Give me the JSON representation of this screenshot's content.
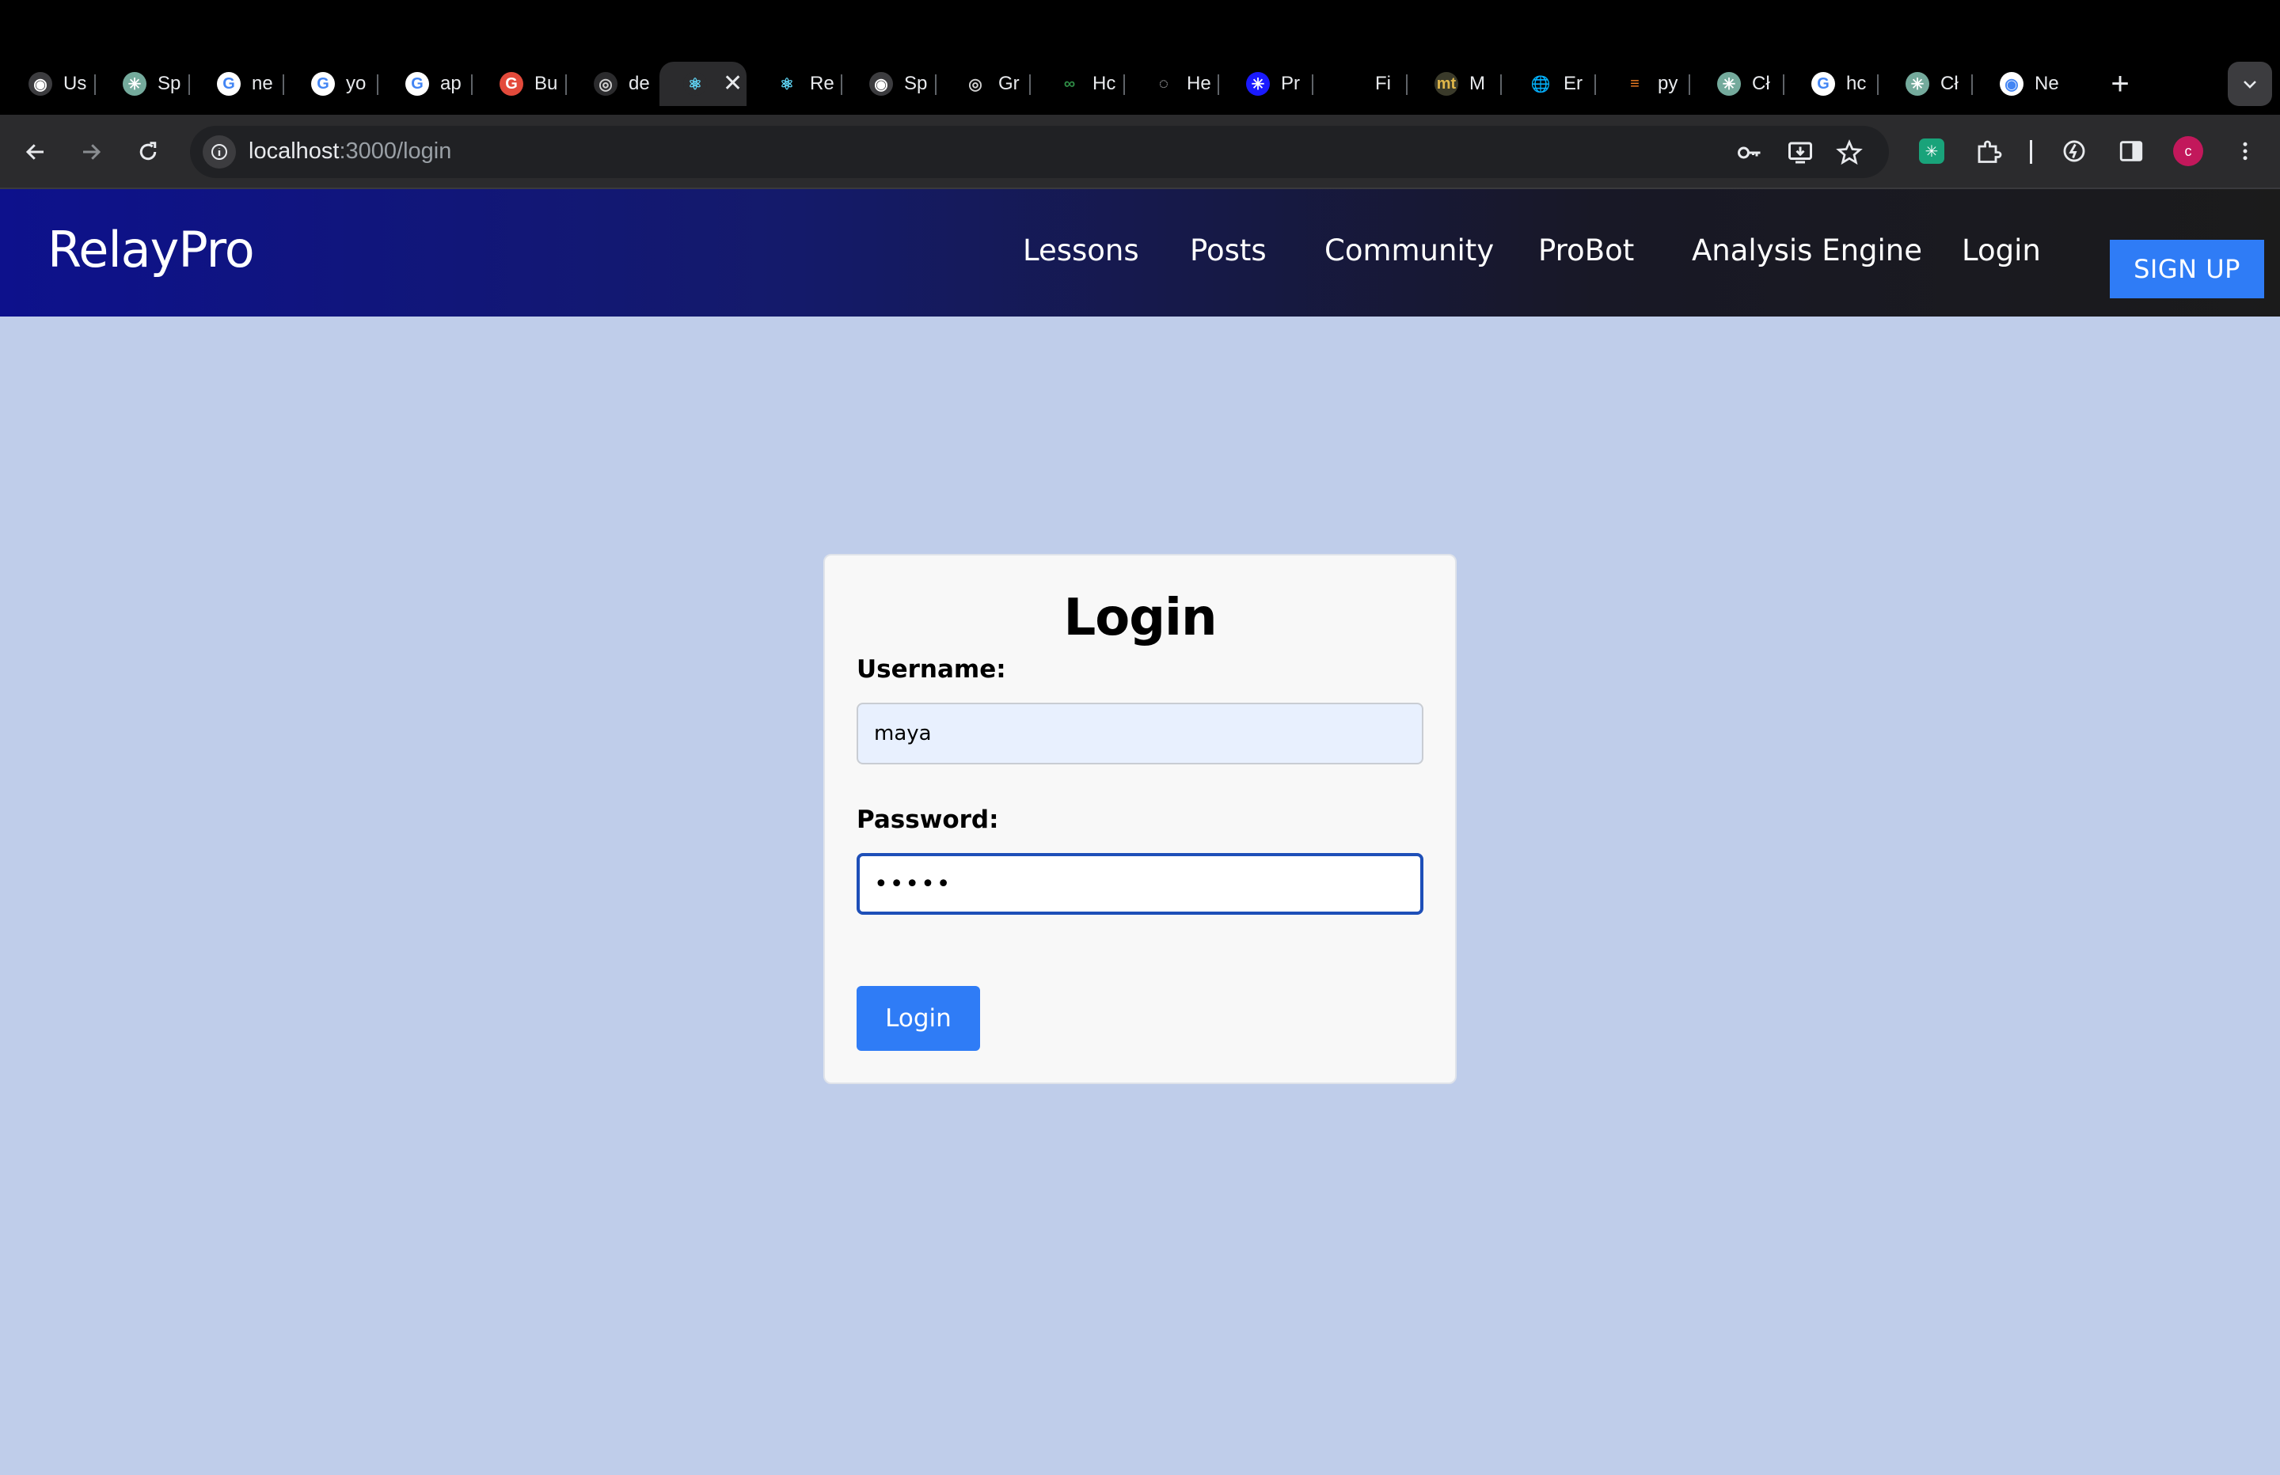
{
  "browser": {
    "tabs": [
      {
        "title": "Us",
        "icon": "github-icon",
        "favicon_bg": "#3c3c3f",
        "favicon_fg": "#ffffff",
        "glyph": "◉"
      },
      {
        "title": "Sp",
        "icon": "chatgpt-icon",
        "favicon_bg": "#74aa9c",
        "favicon_fg": "#ffffff",
        "glyph": "✳"
      },
      {
        "title": "ne",
        "icon": "google-icon",
        "favicon_bg": "#ffffff",
        "favicon_fg": "#4285f4",
        "glyph": "G"
      },
      {
        "title": "yo",
        "icon": "google-icon",
        "favicon_bg": "#ffffff",
        "favicon_fg": "#4285f4",
        "glyph": "G"
      },
      {
        "title": "ap",
        "icon": "google-icon",
        "favicon_bg": "#ffffff",
        "favicon_fg": "#4285f4",
        "glyph": "G"
      },
      {
        "title": "Bu",
        "icon": "grammarly-icon",
        "favicon_bg": "#e34a3b",
        "favicon_fg": "#ffffff",
        "glyph": "G"
      },
      {
        "title": "de",
        "icon": "settings-cog-icon",
        "favicon_bg": "#2b2b2d",
        "favicon_fg": "#cfcfcf",
        "glyph": "◎"
      },
      {
        "title": "",
        "icon": "react-icon",
        "favicon_bg": "#2b2b2d",
        "favicon_fg": "#61dafb",
        "glyph": "⚛",
        "active": true
      },
      {
        "title": "Re",
        "icon": "react-icon",
        "favicon_bg": "#000000",
        "favicon_fg": "#61dafb",
        "glyph": "⚛"
      },
      {
        "title": "Sp",
        "icon": "github-icon",
        "favicon_bg": "#3c3c3f",
        "favicon_fg": "#ffffff",
        "glyph": "◉"
      },
      {
        "title": "Gr",
        "icon": "settings-cog-icon",
        "favicon_bg": "#000000",
        "favicon_fg": "#cfcfcf",
        "glyph": "◎"
      },
      {
        "title": "Hc",
        "icon": "geeksforgeeks-icon",
        "favicon_bg": "#000000",
        "favicon_fg": "#2f8d46",
        "glyph": "∞"
      },
      {
        "title": "He",
        "icon": "loading-spinner-icon",
        "favicon_bg": "#000000",
        "favicon_fg": "#e8eaed",
        "glyph": "◌"
      },
      {
        "title": "Pr",
        "icon": "openai-icon",
        "favicon_bg": "#1a1aff",
        "favicon_fg": "#ffffff",
        "glyph": "✳"
      },
      {
        "title": "Fi",
        "icon": "blank-icon",
        "favicon_bg": "#000000",
        "favicon_fg": "#000000",
        "glyph": ""
      },
      {
        "title": "M",
        "icon": "mt-icon",
        "favicon_bg": "#3a3a2a",
        "favicon_fg": "#e0b74a",
        "glyph": "mt"
      },
      {
        "title": "Er",
        "icon": "globe-icon",
        "favicon_bg": "#000000",
        "favicon_fg": "#9aa0a6",
        "glyph": "🌐"
      },
      {
        "title": "py",
        "icon": "stackoverflow-icon",
        "favicon_bg": "#000000",
        "favicon_fg": "#f48024",
        "glyph": "≡"
      },
      {
        "title": "Cł",
        "icon": "chatgpt-icon",
        "favicon_bg": "#74aa9c",
        "favicon_fg": "#ffffff",
        "glyph": "✳"
      },
      {
        "title": "hc",
        "icon": "google-icon",
        "favicon_bg": "#ffffff",
        "favicon_fg": "#4285f4",
        "glyph": "G"
      },
      {
        "title": "Cł",
        "icon": "chatgpt-icon",
        "favicon_bg": "#74aa9c",
        "favicon_fg": "#ffffff",
        "glyph": "✳"
      },
      {
        "title": "Ne",
        "icon": "chrome-icon",
        "favicon_bg": "#ffffff",
        "favicon_fg": "#4285f4",
        "glyph": "◉"
      }
    ],
    "url_host": "localhost",
    "url_rest": ":3000/login",
    "profile_initial": "c",
    "profile_color": "#c2185b"
  },
  "site": {
    "brand": "RelayPro",
    "nav": {
      "lessons": "Lessons",
      "posts": "Posts",
      "community": "Community",
      "probot": "ProBot",
      "analysis": "Analysis Engine",
      "login": "Login"
    },
    "signup": "SIGN UP"
  },
  "login_form": {
    "title": "Login",
    "username_label": "Username:",
    "username_value": "maya",
    "password_label": "Password:",
    "password_value": "•••••",
    "submit": "Login"
  },
  "colors": {
    "page_bg": "#bfcdea",
    "accent_button": "#2f7cf6",
    "header_gradient_start": "#0d118c",
    "header_gradient_end": "#1b1b1b"
  }
}
